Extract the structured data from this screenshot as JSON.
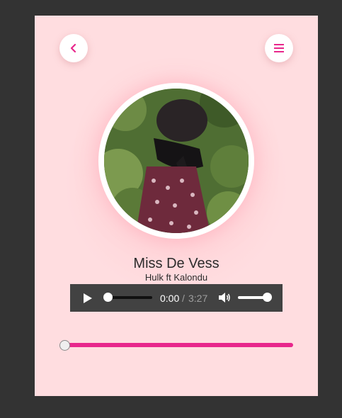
{
  "track": {
    "title": "Miss De Vess",
    "artist": "Hulk ft Kalondu"
  },
  "player": {
    "current_time": "0:00",
    "separator": "/",
    "duration": "3:27",
    "volume": 1.0,
    "position": 0
  },
  "icons": {
    "back": "chevron-left-icon",
    "menu": "hamburger-menu-icon",
    "play": "play-icon",
    "volume": "speaker-icon"
  },
  "colors": {
    "accent": "#e8278c",
    "card_background": "#ffdde0",
    "page_background": "#333333"
  }
}
